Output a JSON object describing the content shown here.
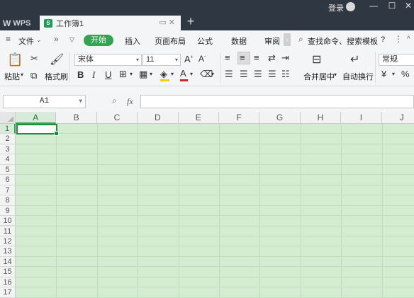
{
  "titlebar": {
    "logo": "WPS",
    "tab_title": "工作簿1",
    "login": "登录",
    "new_tab": "+"
  },
  "menu": {
    "file": "文件",
    "start": "开始",
    "insert": "插入",
    "page_layout": "页面布局",
    "formula": "公式",
    "data": "数据",
    "review": "审阅",
    "search": "查找命令、搜索模板",
    "help": "?"
  },
  "ribbon": {
    "paste": "粘贴",
    "format_painter": "格式刷",
    "font_name": "宋体",
    "font_size": "11",
    "merge_center": "合并居中",
    "wrap_text": "自动换行",
    "number_format": "常规"
  },
  "formula_bar": {
    "cell_ref": "A1",
    "fx": "fx",
    "formula_value": ""
  },
  "sheet": {
    "columns": [
      "A",
      "B",
      "C",
      "D",
      "E",
      "F",
      "G",
      "H",
      "I",
      "J"
    ],
    "rows": [
      "1",
      "2",
      "3",
      "4",
      "5",
      "6",
      "7",
      "8",
      "9",
      "10",
      "11",
      "12",
      "13",
      "14",
      "15",
      "16",
      "17"
    ],
    "selected_cell": "A1",
    "accent_color": "#2fa451",
    "grid_bg_color": "#d4edd2"
  }
}
